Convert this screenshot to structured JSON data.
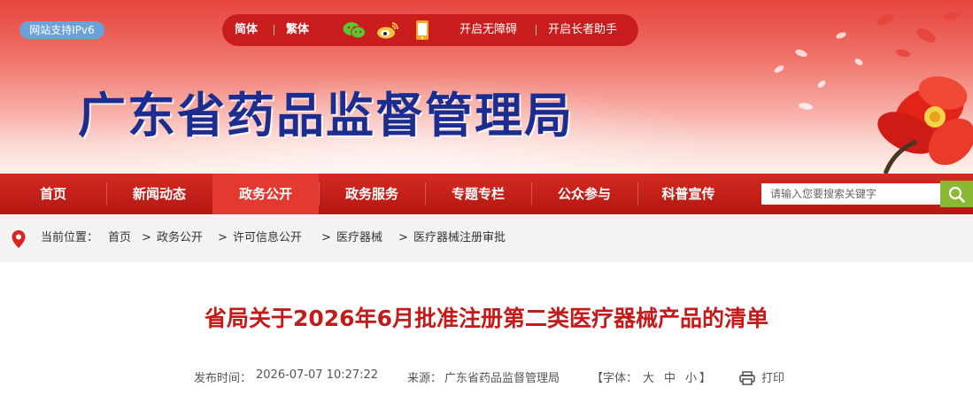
{
  "header": {
    "ipv6_badge": "网站支持IPv6",
    "lang_simplified": "简体",
    "lang_traditional": "繁体",
    "accessibility": "开启无障碍",
    "elderly_mode": "开启长者助手",
    "site_title": "广东省药品监督管理局",
    "icons": [
      "wechat-icon",
      "weibo-icon",
      "mobile-icon"
    ]
  },
  "nav": {
    "items": [
      "首页",
      "新闻动态",
      "政务公开",
      "政务服务",
      "专题专栏",
      "公众参与",
      "科普宣传"
    ],
    "active_index": 2,
    "search_placeholder": "请输入您要搜索关键字"
  },
  "breadcrumb": {
    "label": "当前位置：",
    "items": [
      "首页",
      "政务公开",
      "许可信息公开",
      "医疗器械",
      "医疗器械注册审批"
    ],
    "separator": ">"
  },
  "article": {
    "title": "省局关于2026年6月批准注册第二类医疗器械产品的清单",
    "publish_label": "发布时间：",
    "publish_time": "2026-07-07 10:27:22",
    "source_label": "来源：",
    "source": "广东省药品监督管理局",
    "font_label": "【字体：",
    "font_large": "大",
    "font_medium": "中",
    "font_small": "小",
    "font_close": "】",
    "print": "打印"
  },
  "colors": {
    "nav_red": "#c01c16",
    "title_red": "#c31a1a",
    "site_title_blue": "#1b2d8f",
    "search_green": "#8ab832"
  }
}
